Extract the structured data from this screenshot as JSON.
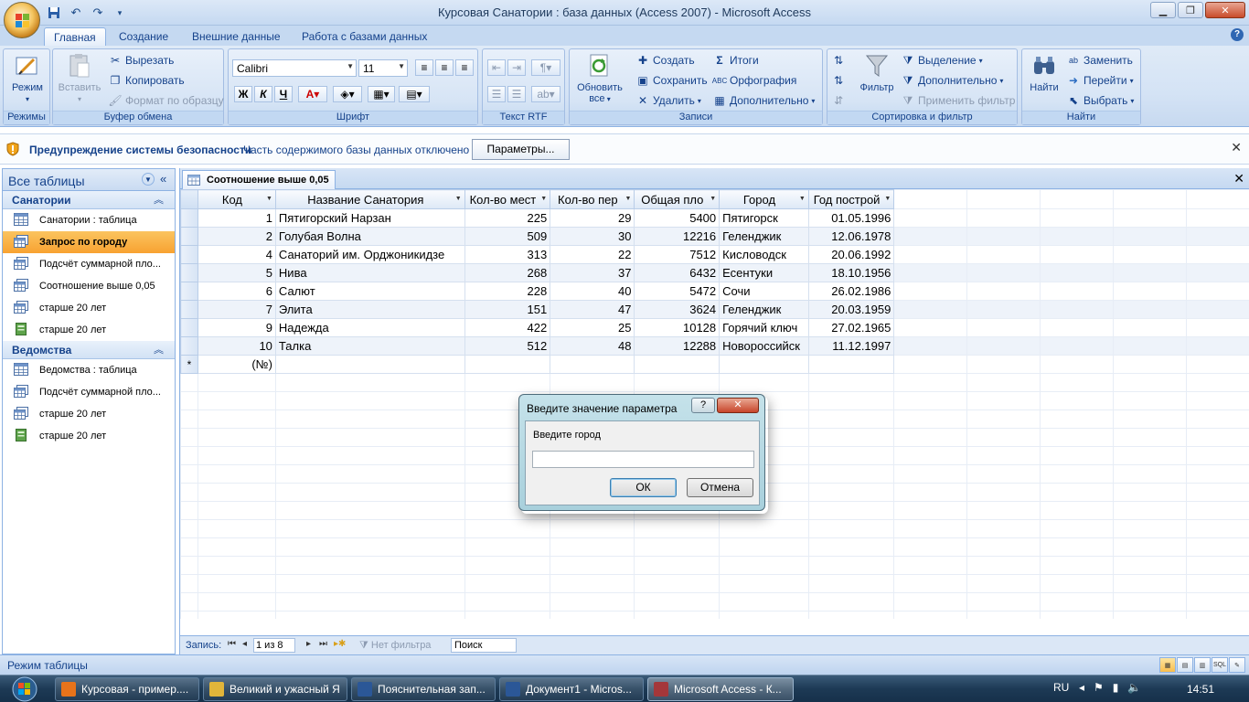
{
  "window": {
    "title": "Курсовая Санатории : база данных (Access 2007) - Microsoft Access"
  },
  "ribbon": {
    "tabs": [
      "Главная",
      "Создание",
      "Внешние данные",
      "Работа с базами данных"
    ],
    "active_tab": "Главная",
    "groups": {
      "views": {
        "label": "Режимы",
        "mode_btn": "Режим"
      },
      "clipboard": {
        "label": "Буфер обмена",
        "paste": "Вставить",
        "cut": "Вырезать",
        "copy": "Копировать",
        "format_painter": "Формат по образцу"
      },
      "font": {
        "label": "Шрифт",
        "font_name": "Calibri",
        "font_size": "11"
      },
      "rtf": {
        "label": "Текст RTF"
      },
      "records": {
        "label": "Записи",
        "refresh": "Обновить",
        "refresh2": "все",
        "create": "Создать",
        "save": "Сохранить",
        "delete": "Удалить",
        "totals": "Итоги",
        "spelling": "Орфография",
        "more": "Дополнительно"
      },
      "sort": {
        "label": "Сортировка и фильтр",
        "filter": "Фильтр",
        "selection": "Выделение",
        "advanced": "Дополнительно",
        "apply_filter": "Применить фильтр"
      },
      "find": {
        "label": "Найти",
        "find": "Найти",
        "replace": "Заменить",
        "goto": "Перейти",
        "select": "Выбрать"
      }
    }
  },
  "security_bar": {
    "title": "Предупреждение системы безопасности",
    "message": "Часть содержимого базы данных отключено",
    "button": "Параметры..."
  },
  "nav_pane": {
    "title": "Все таблицы",
    "groups": [
      {
        "name": "Санатории",
        "items": [
          {
            "label": "Санатории : таблица",
            "icon": "table-icon"
          },
          {
            "label": "Запрос по городу",
            "icon": "query-icon",
            "selected": true
          },
          {
            "label": "Подсчёт суммарной пло...",
            "icon": "query-icon"
          },
          {
            "label": "Соотношение выше 0,05",
            "icon": "query-icon"
          },
          {
            "label": "старше 20 лет",
            "icon": "query-icon"
          },
          {
            "label": "старше 20 лет",
            "icon": "report-icon"
          }
        ]
      },
      {
        "name": "Ведомства",
        "items": [
          {
            "label": "Ведомства : таблица",
            "icon": "table-icon"
          },
          {
            "label": "Подсчёт суммарной пло...",
            "icon": "query-icon"
          },
          {
            "label": "старше 20 лет",
            "icon": "query-icon"
          },
          {
            "label": "старше 20 лет",
            "icon": "report-icon"
          }
        ]
      }
    ]
  },
  "document": {
    "tab_title": "Соотношение выше 0,05",
    "columns": [
      "Код",
      "Название Санатория",
      "Кол-во мест",
      "Кол-во пер",
      "Общая пло",
      "Город",
      "Год построй"
    ],
    "rows": [
      [
        "1",
        "Пятигорский Нарзан",
        "225",
        "29",
        "5400",
        "Пятигорск",
        "01.05.1996"
      ],
      [
        "2",
        "Голубая Волна",
        "509",
        "30",
        "12216",
        "Геленджик",
        "12.06.1978"
      ],
      [
        "4",
        "Санаторий им. Орджоникидзе",
        "313",
        "22",
        "7512",
        "Кисловодск",
        "20.06.1992"
      ],
      [
        "5",
        "Нива",
        "268",
        "37",
        "6432",
        "Есентуки",
        "18.10.1956"
      ],
      [
        "6",
        "Салют",
        "228",
        "40",
        "5472",
        "Сочи",
        "26.02.1986"
      ],
      [
        "7",
        "Элита",
        "151",
        "47",
        "3624",
        "Геленджик",
        "20.03.1959"
      ],
      [
        "9",
        "Надежда",
        "422",
        "25",
        "10128",
        "Горячий ключ",
        "27.02.1965"
      ],
      [
        "10",
        "Талка",
        "512",
        "48",
        "12288",
        "Новороссийск",
        "11.12.1997"
      ]
    ],
    "new_row_marker": "*",
    "new_row_code": "(№)",
    "record_nav": {
      "label": "Запись:",
      "position": "1 из 8",
      "no_filter": "Нет фильтра",
      "search": "Поиск"
    }
  },
  "dialog": {
    "title": "Введите значение параметра",
    "prompt": "Введите город",
    "input_value": "",
    "ok": "ОК",
    "cancel": "Отмена"
  },
  "status_bar": {
    "text": "Режим таблицы"
  },
  "taskbar": {
    "items": [
      {
        "label": "Курсовая - пример....",
        "color": "#e8731a"
      },
      {
        "label": "Великий и ужасный Я",
        "color": "#e1b53a"
      },
      {
        "label": "Пояснительная зап...",
        "color": "#2b5797"
      },
      {
        "label": "Документ1 - Micros...",
        "color": "#2b5797"
      },
      {
        "label": "Microsoft Access - К...",
        "color": "#a4373a",
        "active": true
      }
    ],
    "lang": "RU",
    "clock": "14:51"
  }
}
